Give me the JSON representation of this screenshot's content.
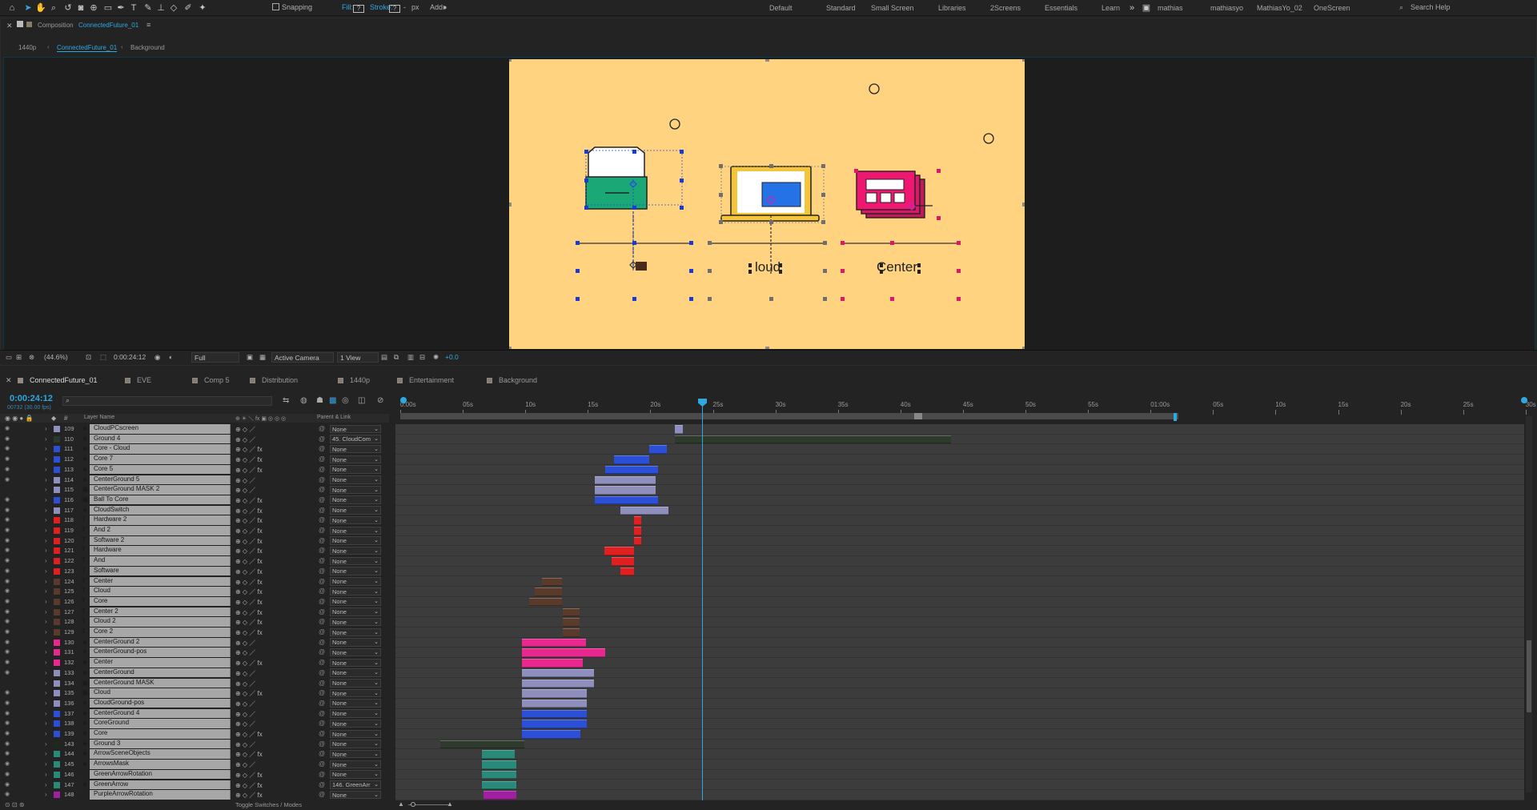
{
  "toolbar": {
    "snapping_label": "Snapping",
    "fill_label": "Fill:",
    "fill_value": "?",
    "stroke_label": "Stroke:",
    "stroke_value": "?",
    "stroke_unit": "px",
    "add_label": "Add:",
    "workspaces": [
      "Default",
      "Standard",
      "Small Screen",
      "Libraries",
      "2Screens",
      "Essentials",
      "Learn",
      "mathias",
      "mathiasyo",
      "MathiasYo_02",
      "OneScreen"
    ],
    "search_placeholder": "Search Help"
  },
  "composition_panel": {
    "label": "Composition",
    "comp_name": "ConnectedFuture_01",
    "breadcrumb": [
      "1440p",
      "ConnectedFuture_01",
      "Background"
    ]
  },
  "artboard": {
    "bg_color": "#ffd380",
    "texts": [
      "loud",
      "Center"
    ]
  },
  "view_bar": {
    "zoom": "(44.6%)",
    "timecode": "0:00:24:12",
    "resolution": "Full",
    "camera": "Active Camera",
    "views": "1 View",
    "exposure": "+0.0"
  },
  "timeline_tabs": [
    "ConnectedFuture_01",
    "EVE",
    "Comp 5",
    "Distribution",
    "1440p",
    "Entertainment",
    "Background"
  ],
  "timeline": {
    "current_time": "0:00:24:12",
    "frame_info": "00732 (30.00 fps)",
    "col_layer_name": "Layer Name",
    "col_parent": "Parent & Link",
    "ruler_ticks": [
      "0:00s",
      "05s",
      "10s",
      "15s",
      "20s",
      "25s",
      "30s",
      "35s",
      "40s",
      "45s",
      "50s",
      "55s",
      "01:00s",
      "05s",
      "10s",
      "15s",
      "20s",
      "25s",
      "30s"
    ],
    "toggle_label": "Toggle Switches / Modes",
    "layers": [
      {
        "num": "109",
        "name": "CloudPCscreen",
        "type": "star",
        "color": "#8f8fbd",
        "parent": "None",
        "fx": false,
        "bar": [
          843,
          853
        ],
        "bcolor": "#8f8fbd",
        "eye": true
      },
      {
        "num": "110",
        "name": "Ground 4",
        "type": "star",
        "color": "#2a3a2a",
        "parent": "45. CloudCom",
        "fx": false,
        "bar": [
          843,
          1188
        ],
        "bcolor": "#2e3a2c",
        "eye": true
      },
      {
        "num": "111",
        "name": "Core - Cloud",
        "type": "star",
        "color": "#2b4fd6",
        "parent": "None",
        "fx": true,
        "bar": [
          811,
          833
        ],
        "bcolor": "#2b4fd6",
        "eye": true
      },
      {
        "num": "112",
        "name": "Core 7",
        "type": "star",
        "color": "#2b4fd6",
        "parent": "None",
        "fx": true,
        "bar": [
          767,
          811
        ],
        "bcolor": "#2b4fd6",
        "eye": true
      },
      {
        "num": "113",
        "name": "Core 5",
        "type": "star",
        "color": "#2b4fd6",
        "parent": "None",
        "fx": true,
        "bar": [
          756,
          822
        ],
        "bcolor": "#2b4fd6",
        "eye": true
      },
      {
        "num": "114",
        "name": "CenterGround 5",
        "type": "star",
        "color": "#8f8fbd",
        "parent": "None",
        "fx": false,
        "bar": [
          743,
          819
        ],
        "bcolor": "#8f8fbd",
        "eye": true
      },
      {
        "num": "115",
        "name": "CenterGround MASK 2",
        "type": "comp",
        "color": "#8f8fbd",
        "parent": "None",
        "fx": false,
        "bar": [
          743,
          819
        ],
        "bcolor": "#8f8fbd",
        "eye": false
      },
      {
        "num": "116",
        "name": "Ball To Core",
        "type": "comp",
        "color": "#2b4fd6",
        "parent": "None",
        "fx": true,
        "bar": [
          743,
          822
        ],
        "bcolor": "#2b4fd6",
        "eye": true
      },
      {
        "num": "117",
        "name": "CloudSwitch",
        "type": "star",
        "color": "#8f8fbd",
        "parent": "None",
        "fx": true,
        "bar": [
          775,
          835
        ],
        "bcolor": "#8f8fbd",
        "eye": true
      },
      {
        "num": "118",
        "name": "Hardware 2",
        "type": "T",
        "color": "#e02020",
        "parent": "None",
        "fx": true,
        "bar": [
          792,
          801
        ],
        "bcolor": "#e02020",
        "eye": true
      },
      {
        "num": "119",
        "name": "And 2",
        "type": "T",
        "color": "#e02020",
        "parent": "None",
        "fx": true,
        "bar": [
          792,
          801
        ],
        "bcolor": "#e02020",
        "eye": true
      },
      {
        "num": "120",
        "name": "Software 2",
        "type": "T",
        "color": "#e02020",
        "parent": "None",
        "fx": true,
        "bar": [
          792,
          801
        ],
        "bcolor": "#e02020",
        "eye": true
      },
      {
        "num": "121",
        "name": "Hardware",
        "type": "T",
        "color": "#e02020",
        "parent": "None",
        "fx": true,
        "bar": [
          755,
          792
        ],
        "bcolor": "#e02020",
        "eye": true
      },
      {
        "num": "122",
        "name": "And",
        "type": "T",
        "color": "#e02020",
        "parent": "None",
        "fx": true,
        "bar": [
          764,
          792
        ],
        "bcolor": "#e02020",
        "eye": true
      },
      {
        "num": "123",
        "name": "Software",
        "type": "T",
        "color": "#e02020",
        "parent": "None",
        "fx": true,
        "bar": [
          775,
          792
        ],
        "bcolor": "#e02020",
        "eye": true
      },
      {
        "num": "124",
        "name": "Center",
        "type": "T",
        "color": "#5a3a2a",
        "parent": "None",
        "fx": true,
        "bar": [
          677,
          702
        ],
        "bcolor": "#5a3a2a",
        "eye": true
      },
      {
        "num": "125",
        "name": "Cloud",
        "type": "T",
        "color": "#5a3a2a",
        "parent": "None",
        "fx": true,
        "bar": [
          668,
          702
        ],
        "bcolor": "#5a3a2a",
        "eye": true
      },
      {
        "num": "126",
        "name": "Core",
        "type": "T",
        "color": "#5a3a2a",
        "parent": "None",
        "fx": true,
        "bar": [
          661,
          702
        ],
        "bcolor": "#5a3a2a",
        "eye": true
      },
      {
        "num": "127",
        "name": "Center 2",
        "type": "T",
        "color": "#5a3a2a",
        "parent": "None",
        "fx": true,
        "bar": [
          703,
          724
        ],
        "bcolor": "#5a3a2a",
        "eye": true
      },
      {
        "num": "128",
        "name": "Cloud 2",
        "type": "T",
        "color": "#5a3a2a",
        "parent": "None",
        "fx": true,
        "bar": [
          703,
          724
        ],
        "bcolor": "#5a3a2a",
        "eye": true
      },
      {
        "num": "129",
        "name": "Core 2",
        "type": "T",
        "color": "#5a3a2a",
        "parent": "None",
        "fx": true,
        "bar": [
          703,
          724
        ],
        "bcolor": "#5a3a2a",
        "eye": true
      },
      {
        "num": "130",
        "name": "CenterGround 2",
        "type": "star",
        "color": "#e8288e",
        "parent": "None",
        "fx": false,
        "bar": [
          652,
          732
        ],
        "bcolor": "#e8288e",
        "eye": true
      },
      {
        "num": "131",
        "name": "CenterGround-pos",
        "type": "star",
        "color": "#e8288e",
        "parent": "None",
        "fx": false,
        "bar": [
          652,
          756
        ],
        "bcolor": "#e8288e",
        "eye": true
      },
      {
        "num": "132",
        "name": "Center",
        "type": "star",
        "color": "#e8288e",
        "parent": "None",
        "fx": true,
        "bar": [
          652,
          728
        ],
        "bcolor": "#e8288e",
        "eye": true
      },
      {
        "num": "133",
        "name": "CenterGround",
        "type": "star",
        "color": "#8f8fbd",
        "parent": "None",
        "fx": false,
        "bar": [
          652,
          742
        ],
        "bcolor": "#8f8fbd",
        "eye": true
      },
      {
        "num": "134",
        "name": "CenterGround MASK",
        "type": "comp",
        "color": "#8f8fbd",
        "parent": "None",
        "fx": false,
        "bar": [
          652,
          742
        ],
        "bcolor": "#8f8fbd",
        "eye": false
      },
      {
        "num": "135",
        "name": "Cloud",
        "type": "comp",
        "color": "#8f8fbd",
        "parent": "None",
        "fx": true,
        "bar": [
          652,
          733
        ],
        "bcolor": "#8f8fbd",
        "eye": true
      },
      {
        "num": "136",
        "name": "CloudGround-pos",
        "type": "star",
        "color": "#8f8fbd",
        "parent": "None",
        "fx": false,
        "bar": [
          652,
          733
        ],
        "bcolor": "#8f8fbd",
        "eye": true
      },
      {
        "num": "137",
        "name": "CenterGround 4",
        "type": "star",
        "color": "#2b4fd6",
        "parent": "None",
        "fx": false,
        "bar": [
          652,
          733
        ],
        "bcolor": "#2b4fd6",
        "eye": true
      },
      {
        "num": "138",
        "name": "CoreGround",
        "type": "star",
        "color": "#2b4fd6",
        "parent": "None",
        "fx": false,
        "bar": [
          652,
          733
        ],
        "bcolor": "#2b4fd6",
        "eye": true
      },
      {
        "num": "139",
        "name": "Core",
        "type": "star",
        "color": "#2b4fd6",
        "parent": "None",
        "fx": true,
        "bar": [
          652,
          725
        ],
        "bcolor": "#2b4fd6",
        "eye": true
      },
      {
        "num": "143",
        "name": "Ground 3",
        "type": "star",
        "color": "#1e2a1e",
        "parent": "None",
        "fx": false,
        "bar": [
          550,
          655
        ],
        "bcolor": "#2e3a2c",
        "eye": true
      },
      {
        "num": "144",
        "name": "ArrowSceneObjects",
        "type": "star",
        "color": "#2a8a7a",
        "parent": "None",
        "fx": true,
        "bar": [
          602,
          643
        ],
        "bcolor": "#2a8a7a",
        "eye": true
      },
      {
        "num": "145",
        "name": "ArrowsMask",
        "type": "star",
        "color": "#2a8a7a",
        "parent": "None",
        "fx": false,
        "bar": [
          602,
          645
        ],
        "bcolor": "#2a8a7a",
        "eye": true
      },
      {
        "num": "146",
        "name": "GreenArrowRotation",
        "type": "box",
        "color": "#2a8a7a",
        "parent": "None",
        "fx": true,
        "bar": [
          602,
          645
        ],
        "bcolor": "#2a8a7a",
        "eye": true
      },
      {
        "num": "147",
        "name": "GreenArrow",
        "type": "star",
        "color": "#2a8a7a",
        "parent": "146. GreenArr",
        "fx": true,
        "bar": [
          602,
          645
        ],
        "bcolor": "#2a8a7a",
        "eye": true
      },
      {
        "num": "148",
        "name": "PurpleArrowRotation",
        "type": "box",
        "color": "#a020a0",
        "parent": "None",
        "fx": true,
        "bar": [
          604,
          645
        ],
        "bcolor": "#a020a0",
        "eye": true
      }
    ]
  }
}
